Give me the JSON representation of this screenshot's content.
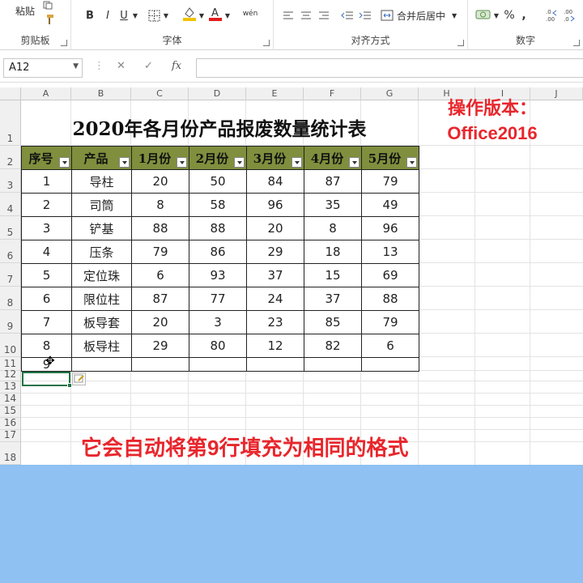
{
  "ribbon": {
    "clipboard": {
      "paste": "粘贴",
      "label": "剪贴板"
    },
    "font": {
      "label": "字体",
      "bold": "B",
      "italic": "I",
      "underline": "U",
      "fill_color": "#f2c200",
      "font_color": "#e31c1c",
      "wen": "wén"
    },
    "align": {
      "label": "对齐方式",
      "merge": "合并后居中"
    },
    "number": {
      "label": "数字",
      "percent": "%",
      "comma": ","
    }
  },
  "formula_bar": {
    "name_box": "A12",
    "fx": "fx",
    "cancel": "✕",
    "enter": "✓",
    "value": ""
  },
  "columns": [
    "A",
    "B",
    "C",
    "D",
    "E",
    "F",
    "G",
    "H",
    "I",
    "J"
  ],
  "rows": [
    "1",
    "2",
    "3",
    "4",
    "5",
    "6",
    "7",
    "8",
    "9",
    "10",
    "11",
    "12",
    "13",
    "14",
    "15",
    "16",
    "17",
    "18"
  ],
  "table": {
    "title": "2020年各月份产品报废数量统计表",
    "headers": [
      "序号",
      "产品",
      "1月份",
      "2月份",
      "3月份",
      "4月份",
      "5月份"
    ],
    "rows": [
      [
        "1",
        "导柱",
        "20",
        "50",
        "84",
        "87",
        "79"
      ],
      [
        "2",
        "司筒",
        "8",
        "58",
        "96",
        "35",
        "49"
      ],
      [
        "3",
        "铲基",
        "88",
        "88",
        "20",
        "8",
        "96"
      ],
      [
        "4",
        "压条",
        "79",
        "86",
        "29",
        "18",
        "13"
      ],
      [
        "5",
        "定位珠",
        "6",
        "93",
        "37",
        "15",
        "69"
      ],
      [
        "6",
        "限位柱",
        "87",
        "77",
        "24",
        "37",
        "88"
      ],
      [
        "7",
        "板导套",
        "20",
        "3",
        "23",
        "85",
        "79"
      ],
      [
        "8",
        "板导柱",
        "29",
        "80",
        "12",
        "82",
        "6"
      ],
      [
        "9",
        "",
        "",
        "",
        "",
        "",
        ""
      ]
    ],
    "header_color": "#7f8f3d"
  },
  "overlay": {
    "version_line1": "操作版本：",
    "version_line2": "Office2016",
    "caption": "它会自动将第9行填充为相同的格式",
    "text_color": "#e8262c"
  },
  "bottom_band_color": "#8fc1f2"
}
